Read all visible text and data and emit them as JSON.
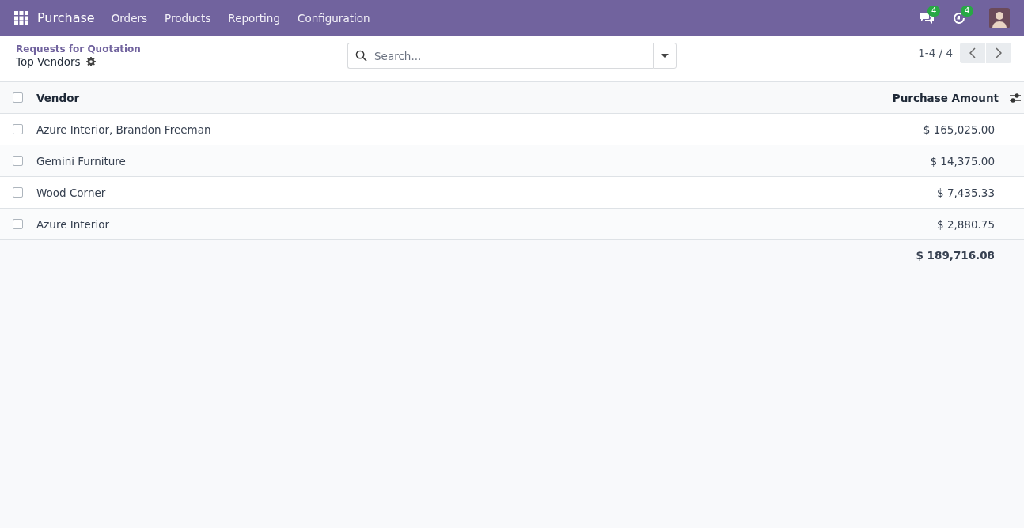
{
  "navbar": {
    "app": "Purchase",
    "menus": [
      "Orders",
      "Products",
      "Reporting",
      "Configuration"
    ],
    "messages_count": "4",
    "activities_count": "4"
  },
  "breadcrumb": {
    "parent": "Requests for Quotation",
    "current": "Top Vendors"
  },
  "search": {
    "placeholder": "Search..."
  },
  "pager": {
    "range": "1-4 / 4"
  },
  "table": {
    "columns": [
      "Vendor",
      "Purchase Amount"
    ],
    "header_checked": false,
    "rows": [
      {
        "vendor": "Azure Interior, Brandon Freeman",
        "amount": "$ 165,025.00",
        "checked": false
      },
      {
        "vendor": "Gemini Furniture",
        "amount": "$ 14,375.00",
        "checked": false
      },
      {
        "vendor": "Wood Corner",
        "amount": "$ 7,435.33",
        "checked": false
      },
      {
        "vendor": "Azure Interior",
        "amount": "$ 2,880.75",
        "checked": false
      }
    ],
    "total": "$ 189,716.08"
  }
}
